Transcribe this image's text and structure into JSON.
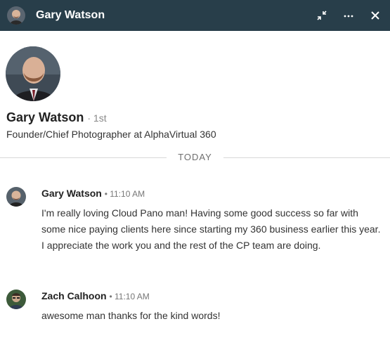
{
  "header": {
    "title": "Gary Watson",
    "icons": [
      "compress-icon",
      "more-icon",
      "close-icon"
    ]
  },
  "profile": {
    "name": "Gary Watson",
    "degree": "· 1st",
    "headline": "Founder/Chief Photographer at AlphaVirtual 360"
  },
  "divider": {
    "label": "TODAY"
  },
  "messages": [
    {
      "sender": "Gary Watson",
      "time": "• 11:10 AM",
      "text": "I'm really loving Cloud Pano man! Having some good success so far with some nice paying clients here since starting my 360 business earlier this year. I appreciate the work you and the rest of the CP team are doing."
    },
    {
      "sender": "Zach Calhoon",
      "time": "• 11:10 AM",
      "text": "awesome man thanks for the kind words!"
    }
  ],
  "colors": {
    "header_bg": "#283e4a",
    "header_text": "#ffffff"
  }
}
